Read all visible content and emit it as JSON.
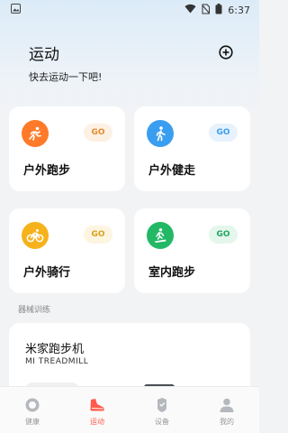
{
  "status_bar": {
    "time": "6:37"
  },
  "header": {
    "title": "运动",
    "subtitle": "快去运动一下吧!"
  },
  "sports": [
    {
      "label": "户外跑步",
      "go": "GO",
      "icon": "outdoor-run-icon",
      "color": "#ff7a29",
      "pill_bg": "#fdf1e4",
      "pill_fg": "#e68a2e"
    },
    {
      "label": "户外健走",
      "go": "GO",
      "icon": "outdoor-walk-icon",
      "color": "#3a9ef0",
      "pill_bg": "#e7f2fc",
      "pill_fg": "#3a9ef0"
    },
    {
      "label": "户外骑行",
      "go": "GO",
      "icon": "outdoor-cycle-icon",
      "color": "#f5b21a",
      "pill_bg": "#fdf5e0",
      "pill_fg": "#d9a020"
    },
    {
      "label": "室内跑步",
      "go": "GO",
      "icon": "indoor-run-icon",
      "color": "#22b865",
      "pill_bg": "#e5f6ec",
      "pill_fg": "#22a860"
    }
  ],
  "equipment": {
    "section_label": "器械训练",
    "title": "米家跑步机",
    "subtitle": "MI TREADMILL"
  },
  "tabs": [
    {
      "label": "健康",
      "icon": "health-icon",
      "active": false
    },
    {
      "label": "运动",
      "icon": "sport-shoe-icon",
      "active": true
    },
    {
      "label": "设备",
      "icon": "device-watch-icon",
      "active": false
    },
    {
      "label": "我的",
      "icon": "profile-icon",
      "active": false
    }
  ],
  "colors": {
    "accent": "#ff5a4a",
    "inactive": "#999999"
  }
}
